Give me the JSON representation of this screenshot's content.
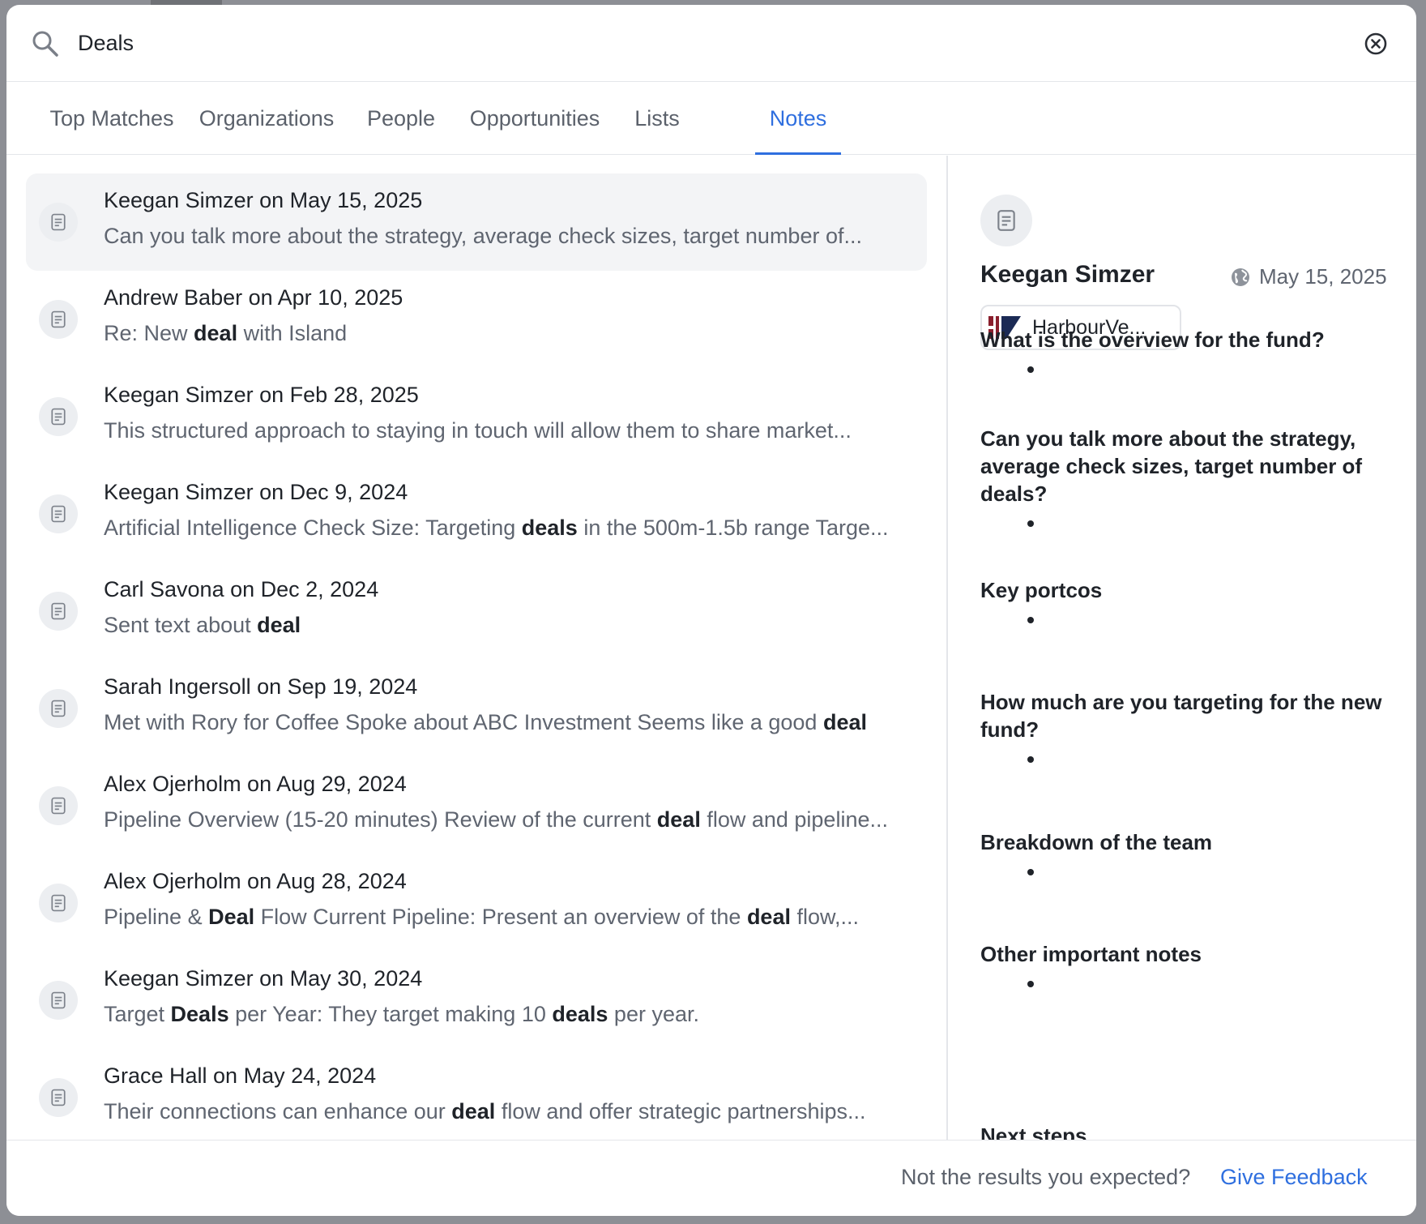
{
  "search": {
    "query": "Deals"
  },
  "tabs": [
    {
      "label": "Top Matches"
    },
    {
      "label": "Organizations"
    },
    {
      "label": "People"
    },
    {
      "label": "Opportunities"
    },
    {
      "label": "Lists"
    },
    {
      "label": "Notes",
      "active": true
    }
  ],
  "results": [
    {
      "title": "Keegan Simzer on May 15, 2025",
      "snippet": [
        [
          "Can you talk more about the strategy, average check sizes, target number of...",
          false
        ]
      ],
      "selected": true
    },
    {
      "title": "Andrew Baber on Apr 10, 2025",
      "snippet": [
        [
          "Re: New ",
          false
        ],
        [
          "deal",
          true
        ],
        [
          " with Island",
          false
        ]
      ]
    },
    {
      "title": "Keegan Simzer on Feb 28, 2025",
      "snippet": [
        [
          "This structured approach to staying in touch will allow them to share market...",
          false
        ]
      ]
    },
    {
      "title": "Keegan Simzer on Dec 9, 2024",
      "snippet": [
        [
          "Artificial Intelligence Check Size: Targeting ",
          false
        ],
        [
          "deals",
          true
        ],
        [
          " in the 500m-1.5b range Targe...",
          false
        ]
      ]
    },
    {
      "title": "Carl Savona on Dec 2, 2024",
      "snippet": [
        [
          "Sent text about ",
          false
        ],
        [
          "deal",
          true
        ]
      ]
    },
    {
      "title": "Sarah Ingersoll on Sep 19, 2024",
      "snippet": [
        [
          "Met with Rory for Coffee Spoke about ABC Investment Seems like a good ",
          false
        ],
        [
          "deal",
          true
        ]
      ]
    },
    {
      "title": "Alex Ojerholm on Aug 29, 2024",
      "snippet": [
        [
          "Pipeline Overview (15-20 minutes) Review of the current ",
          false
        ],
        [
          "deal",
          true
        ],
        [
          " flow and pipeline...",
          false
        ]
      ]
    },
    {
      "title": "Alex Ojerholm on Aug 28, 2024",
      "snippet": [
        [
          "Pipeline & ",
          false
        ],
        [
          "Deal",
          true
        ],
        [
          " Flow Current Pipeline: Present an overview of the ",
          false
        ],
        [
          "deal",
          true
        ],
        [
          " flow,...",
          false
        ]
      ]
    },
    {
      "title": "Keegan Simzer on May 30, 2024",
      "snippet": [
        [
          "Target ",
          false
        ],
        [
          "Deals",
          true
        ],
        [
          " per Year: They target making 10 ",
          false
        ],
        [
          "deals",
          true
        ],
        [
          " per year.",
          false
        ]
      ]
    },
    {
      "title": "Grace Hall on May 24, 2024",
      "snippet": [
        [
          "Their connections can enhance our ",
          false
        ],
        [
          "deal",
          true
        ],
        [
          " flow and offer strategic partnerships...",
          false
        ]
      ]
    }
  ],
  "preview": {
    "author": "Keegan Simzer",
    "date": "May 15, 2025",
    "organization": "HarbourVe...",
    "sections": [
      {
        "heading": "What is the overview for the fund?"
      },
      {
        "heading": "Can you talk more about the strategy, average check sizes, target number of deals?"
      },
      {
        "heading": "Key portcos"
      },
      {
        "heading": "How much are you targeting for the new fund?"
      },
      {
        "heading": "Breakdown of the team"
      },
      {
        "heading": "Other important notes"
      },
      {
        "heading": "Next steps"
      }
    ]
  },
  "footer": {
    "prompt": "Not the results you expected?",
    "link": "Give Feedback"
  },
  "colors": {
    "accent": "#2f6fdf",
    "org_logo_red": "#8a1f2d",
    "org_logo_navy": "#1b2a55"
  }
}
